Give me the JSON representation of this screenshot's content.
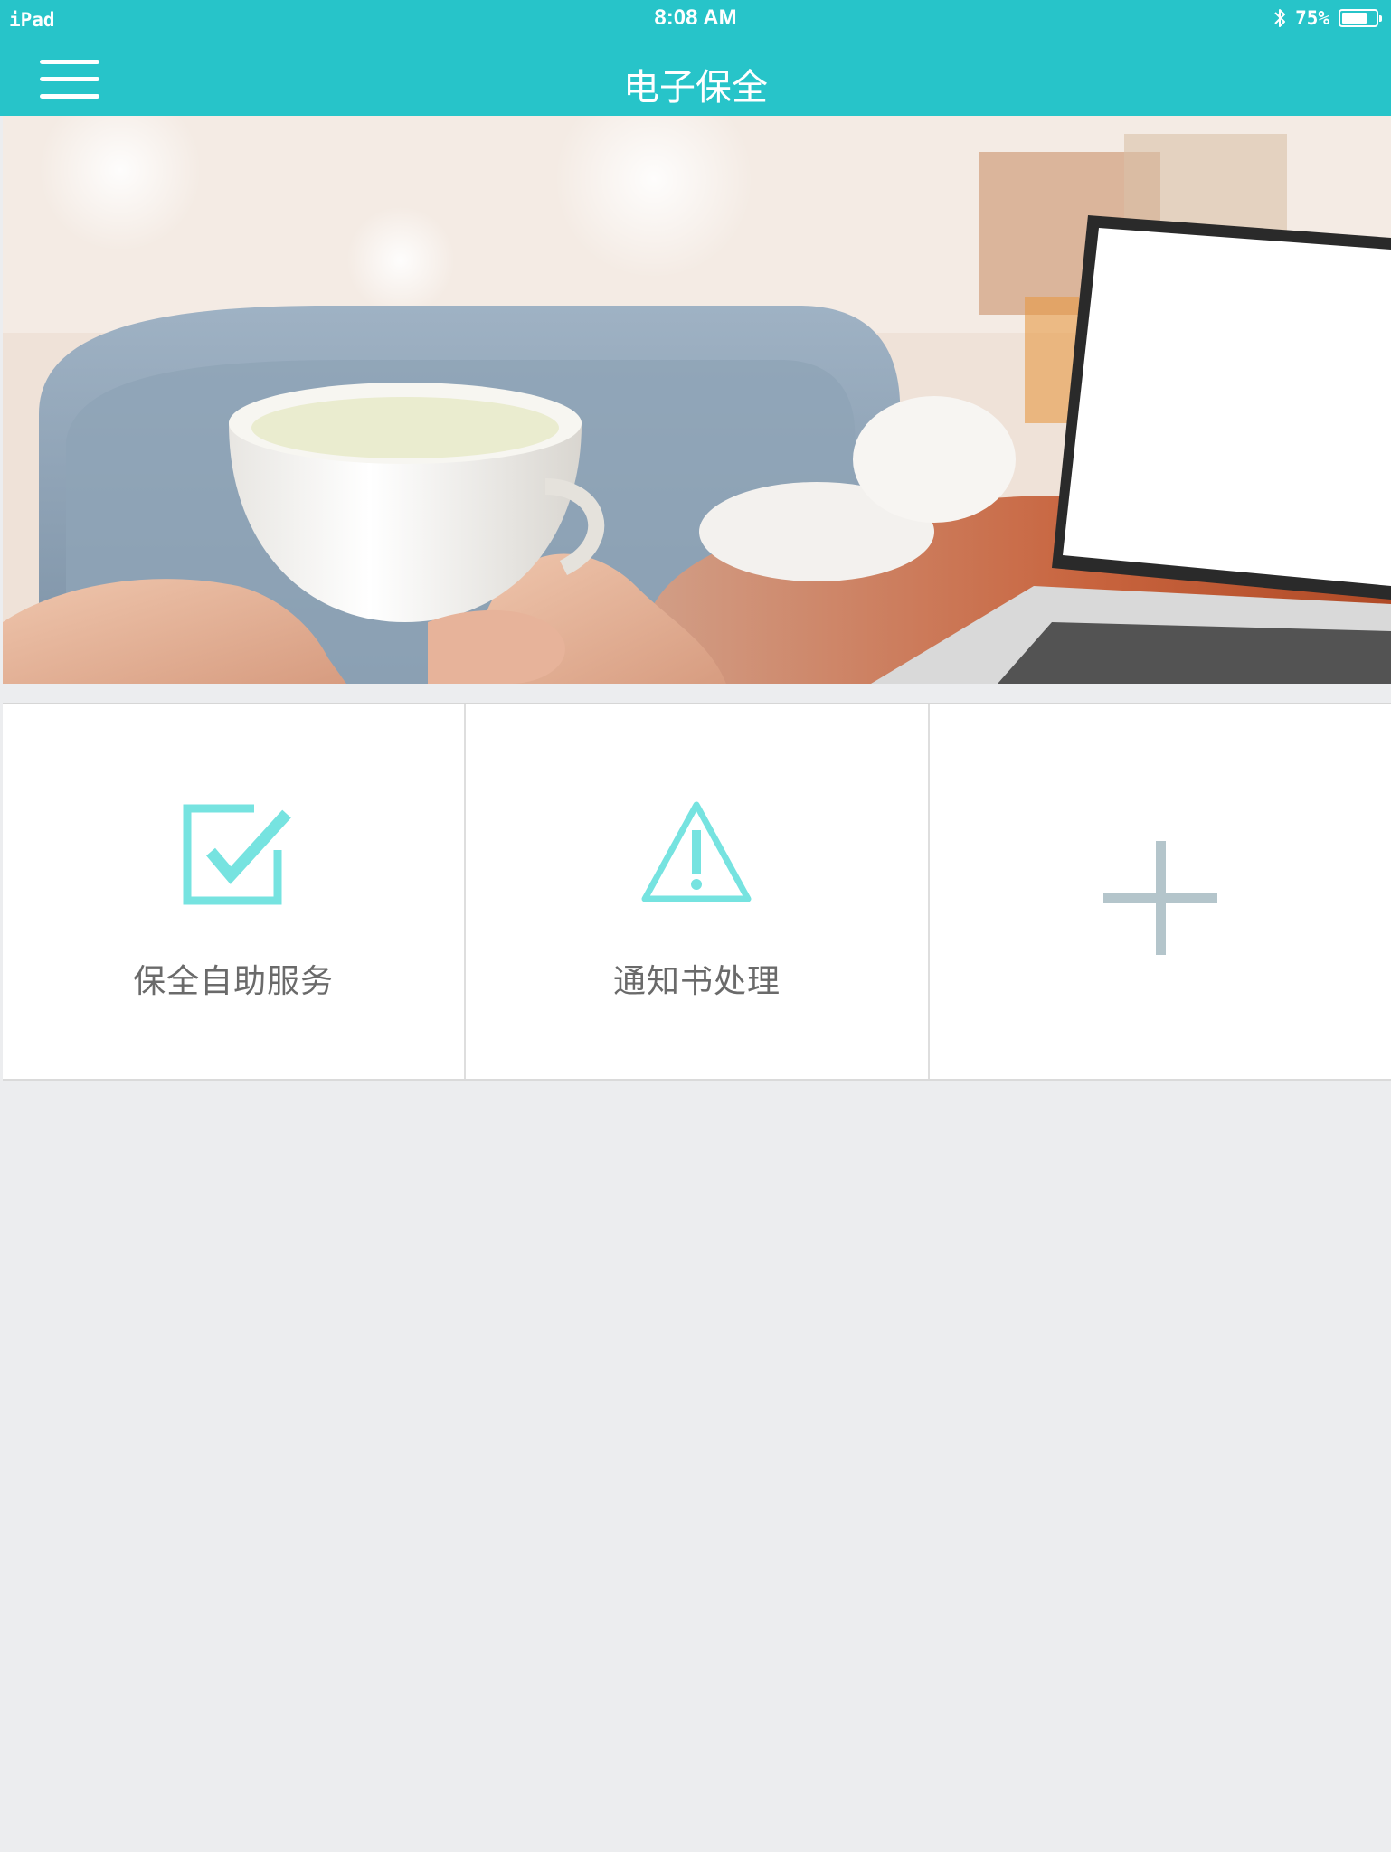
{
  "status_bar": {
    "device": "iPad",
    "time": "8:08 AM",
    "battery_text": "75%",
    "battery_level": 0.75,
    "bluetooth_icon": "bluetooth-icon"
  },
  "nav": {
    "title": "电子保全",
    "menu_icon": "hamburger-menu-icon"
  },
  "hero": {
    "image": "person holding white teacup in front of laptop"
  },
  "tiles": [
    {
      "label": "保全自助服务",
      "icon": "checkbox-check-icon",
      "color": "#76e3e0"
    },
    {
      "label": "通知书处理",
      "icon": "warning-triangle-icon",
      "color": "#76e3e0"
    },
    {
      "label": "",
      "icon": "plus-icon",
      "color": "#b4c5cb"
    }
  ],
  "colors": {
    "brand": "#27c4c9",
    "background": "#ecedef",
    "tile_text": "#6a6a6a"
  }
}
